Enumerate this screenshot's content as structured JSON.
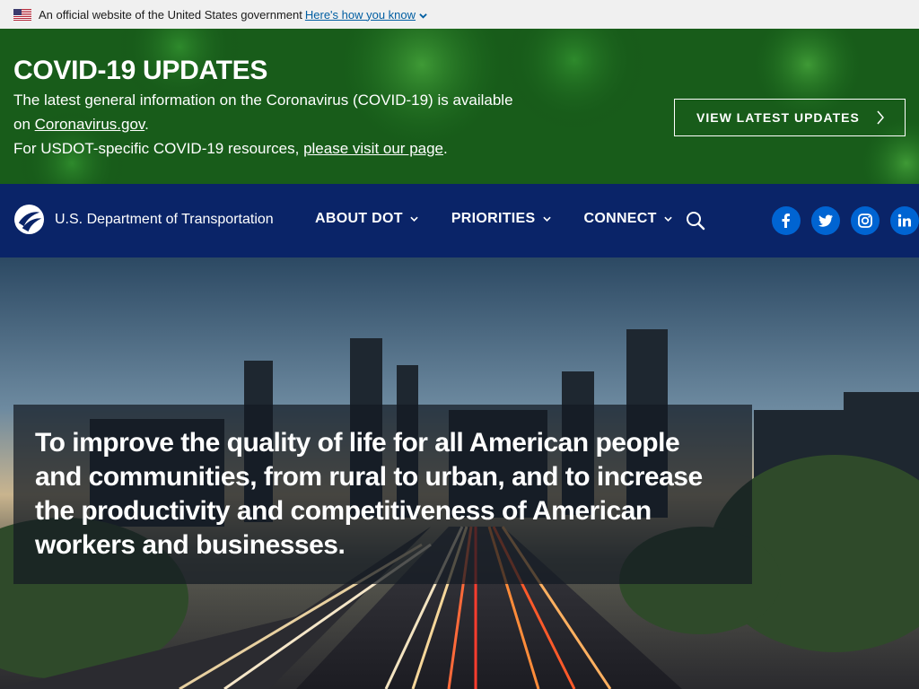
{
  "gov_banner": {
    "text": "An official website of the United States government",
    "link": "Here's how you know"
  },
  "covid": {
    "title": "COVID-19 UPDATES",
    "line1_pre": "The latest general information on the Coronavirus (COVID-19) is available on ",
    "line1_link": "Coronavirus.gov",
    "line1_post": ".",
    "line2_pre": "For USDOT-specific COVID-19 resources, ",
    "line2_link": "please visit our page",
    "line2_post": ".",
    "button": "VIEW LATEST UPDATES"
  },
  "nav": {
    "logo_text": "U.S. Department of Transportation",
    "menu": [
      {
        "label": "ABOUT DOT"
      },
      {
        "label": "PRIORITIES"
      },
      {
        "label": "CONNECT"
      }
    ],
    "social": [
      "facebook-icon",
      "twitter-icon",
      "instagram-icon",
      "linkedin-icon"
    ]
  },
  "hero": {
    "text": "To improve the quality of life for all American people and communities, from rural to urban, and to increase the productivity and competitiveness of American workers and businesses."
  },
  "colors": {
    "covid_green": "#1b6a1e",
    "nav_blue": "#0a2468",
    "social_blue": "#0064d2",
    "link_blue": "#005ea2"
  }
}
